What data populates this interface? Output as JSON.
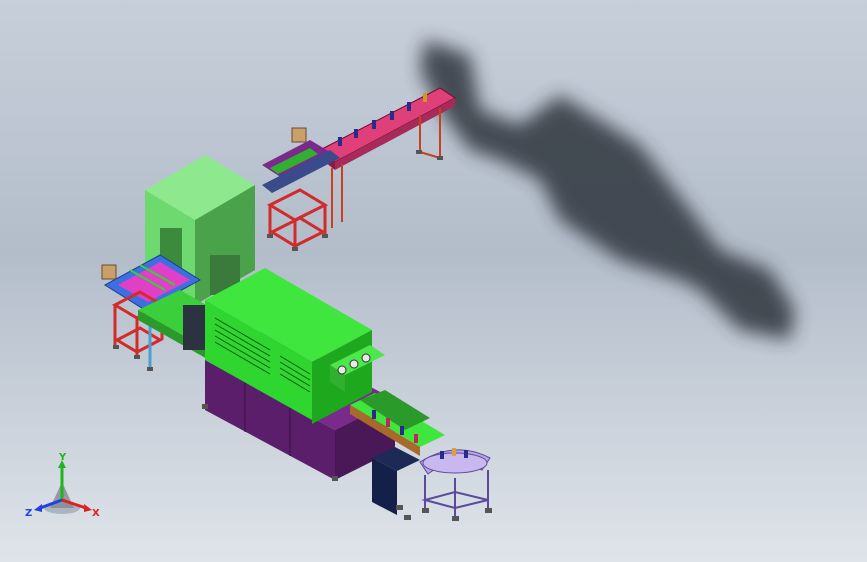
{
  "view": {
    "background_top": "#c7cfda",
    "background_bottom": "#dfe4ea",
    "shadow_color": "#2e343c"
  },
  "assembly": {
    "components": [
      "green-oven-tunnel",
      "green-enclosure-cabinet",
      "pink-inclined-conveyor",
      "left-infeed-conveyor",
      "outfeed-conveyor",
      "rotary-accumulation-table",
      "purple-base-frame"
    ]
  },
  "colors": {
    "oven_green": "#2fd62f",
    "cabinet_green": "#6ed96e",
    "cabinet_dark": "#4aa34a",
    "frame_red": "#d12b2b",
    "conveyor_pink": "#e0407a",
    "base_purple": "#5b1e6b",
    "table_lavender": "#b7a6e6",
    "blue_frame": "#3d6fe0"
  },
  "triad": {
    "x_label": "X",
    "y_label": "Y",
    "z_label": "Z",
    "x_color": "#e02020",
    "y_color": "#1fb51f",
    "z_color": "#2040e0"
  }
}
